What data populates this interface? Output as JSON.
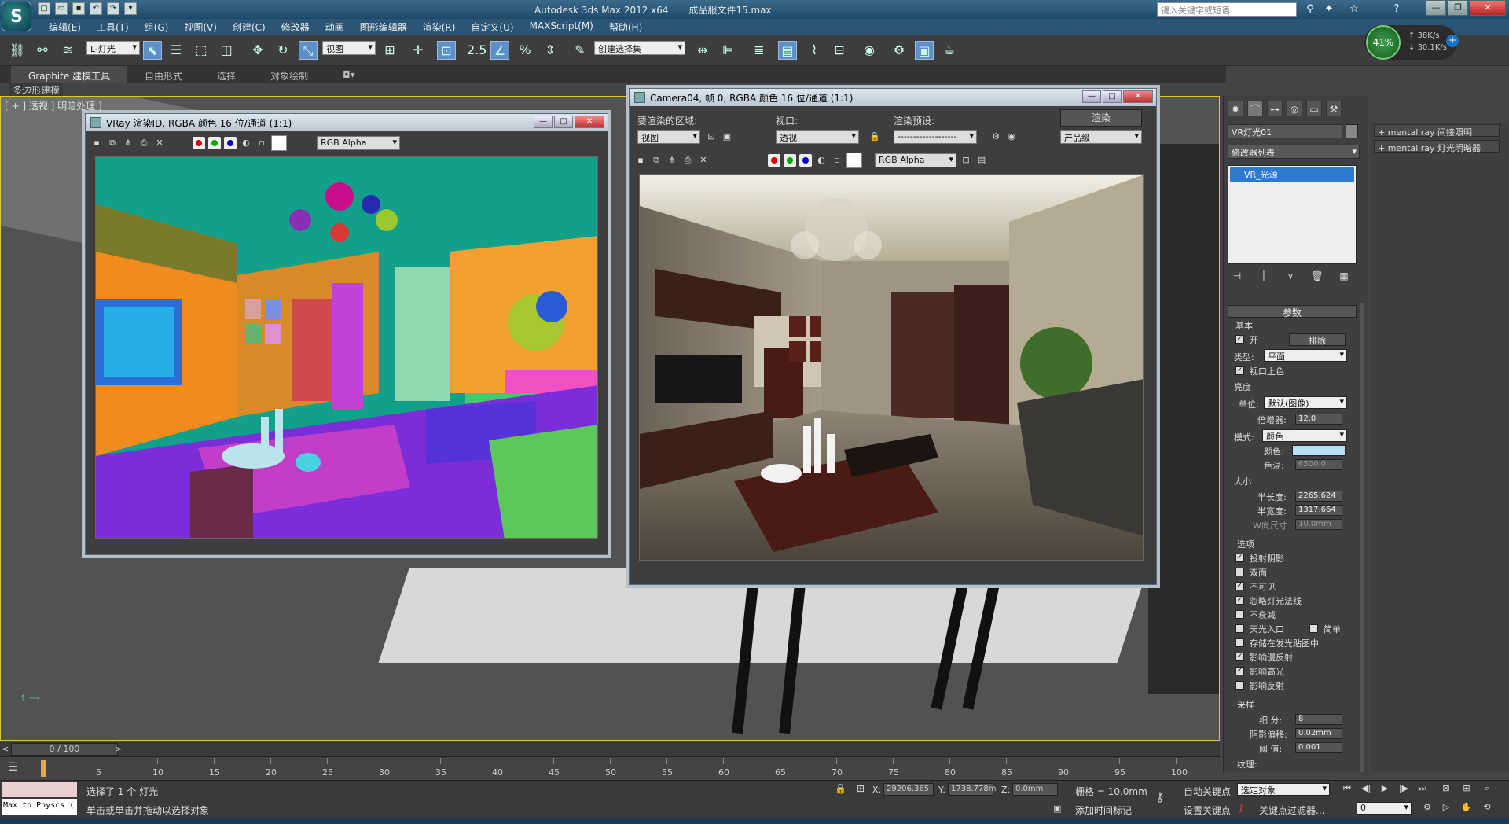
{
  "title": {
    "app": "Autodesk 3ds Max  2012 x64",
    "file": "成品服文件15.max",
    "search_placeholder": "键入关键字或短语"
  },
  "menu": [
    "编辑(E)",
    "工具(T)",
    "组(G)",
    "视图(V)",
    "创建(C)",
    "修改器",
    "动画",
    "图形编辑器",
    "渲染(R)",
    "自定义(U)",
    "MAXScript(M)",
    "帮助(H)"
  ],
  "toolbar": {
    "selection_filter": "L-灯光",
    "ref_coord": "视图",
    "snap_value": "2.5",
    "named_selection": "创建选择集"
  },
  "memory": {
    "percent": "41%",
    "up": "38K/s",
    "down": "30.1K/s"
  },
  "ribbon": {
    "tabs": [
      "Graphite 建模工具",
      "自由形式",
      "选择",
      "对象绘制"
    ],
    "sub": "多边形建模"
  },
  "viewport": {
    "label": "[ + ] 透视 ] 明暗处理 ]"
  },
  "render_id_window": {
    "title": "VRay 渲染ID, RGBA 颜色 16 位/通道 (1:1)",
    "channel": "RGB Alpha"
  },
  "camera_window": {
    "title": "Camera04, 帧 0, RGBA 颜色 16 位/通道 (1:1)",
    "area_label": "要渲染的区域:",
    "area_value": "视图",
    "viewport_label": "视口:",
    "viewport_value": "透视",
    "preset_label": "渲染预设:",
    "preset_value": "-------------------",
    "render_button": "渲染",
    "quality_value": "产品级",
    "channel": "RGB Alpha"
  },
  "command_panel": {
    "object_name": "VR灯光01",
    "modifier_list": "修改器列表",
    "stack_item": "VR_光源",
    "rollout_title": "参数",
    "basic": "基本",
    "on_label": "开",
    "exclude_button": "排除",
    "type_label": "类型:",
    "type_value": "平面",
    "viewport_shade": "视口上色",
    "intensity": "亮度",
    "units_label": "单位:",
    "units_value": "默认(图像)",
    "multiplier_label": "倍增器:",
    "multiplier_value": "12.0",
    "mode_label": "模式:",
    "mode_value": "颜色",
    "color_label": "颜色:",
    "temp_label": "色温:",
    "temp_value": "6500.0",
    "size": "大小",
    "half_length_label": "半长度:",
    "half_length_value": "2265.624",
    "half_width_label": "半宽度:",
    "half_width_value": "1317.664",
    "w_size_label": "W向尺寸",
    "w_size_value": "10.0mm",
    "options": "选项",
    "opt_cast_shadows": "投射阴影",
    "opt_double_sided": "双面",
    "opt_invisible": "不可见",
    "opt_ignore_normals": "忽略灯光法线",
    "opt_no_decay": "不衰减",
    "opt_skylight_portal": "天光入口",
    "opt_simple": "简单",
    "opt_store_irradiance": "存储在发光贴图中",
    "opt_affect_diffuse": "影响漫反射",
    "opt_affect_specular": "影响高光",
    "opt_affect_reflections": "影响反射",
    "sampling": "采样",
    "subdivs_label": "细  分:",
    "subdivs_value": "8",
    "shadow_bias_label": "阴影偏移:",
    "shadow_bias_value": "0.02mm",
    "cutoff_label": "阈  值:",
    "cutoff_value": "0.001",
    "texture": "纹理:"
  },
  "right_list": [
    "mental ray 间接照明",
    "mental ray 灯光明暗器"
  ],
  "timeline": {
    "frame": "0 / 100",
    "ticks": [
      "5",
      "10",
      "15",
      "20",
      "25",
      "30",
      "35",
      "40",
      "45",
      "50",
      "55",
      "60",
      "65",
      "70",
      "75",
      "80",
      "85",
      "90",
      "95",
      "100"
    ]
  },
  "status": {
    "maxscript": "Max to Physcs (",
    "line1": "选择了 1 个 灯光",
    "line2": "单击或单击并拖动以选择对象",
    "x_label": "X:",
    "x_value": "29206.365",
    "y_label": "Y:",
    "y_value": "1738.778m",
    "z_label": "Z:",
    "z_value": "0.0mm",
    "grid": "栅格 = 10.0mm",
    "add_time_tag": "添加时间标记",
    "auto_key": "自动关键点",
    "set_key": "设置关键点",
    "selected_obj": "选定对象",
    "key_filters": "关键点过滤器...",
    "frame_input": "0"
  }
}
